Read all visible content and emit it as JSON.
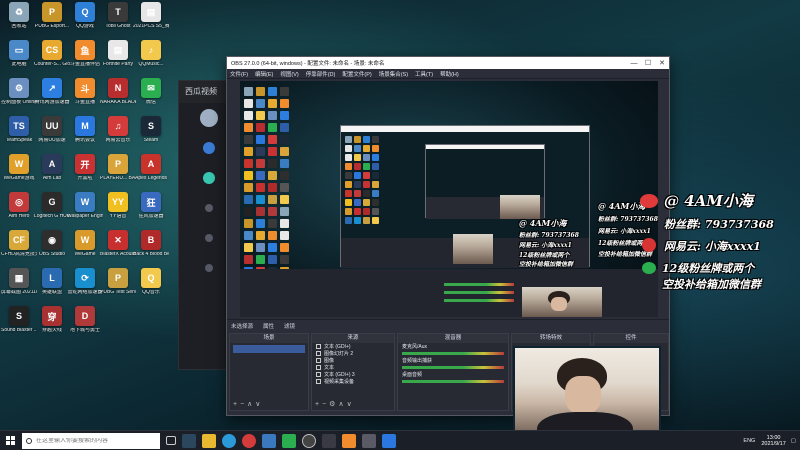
{
  "desktop_icons": [
    {
      "label": "回收站",
      "color": "#8aa4b8",
      "glyph": "♻",
      "icon": "recycle-bin-icon"
    },
    {
      "label": "PUBG Esport...",
      "color": "#c8952a",
      "glyph": "P",
      "icon": "pubg-icon"
    },
    {
      "label": "QQ游戏",
      "color": "#2e7fd6",
      "glyph": "Q",
      "icon": "qq-game-icon"
    },
    {
      "label": "Tobii Ghost",
      "color": "#3a3a3a",
      "glyph": "T",
      "icon": "tobii-icon"
    },
    {
      "label": "2021PCS S5_赛格准...",
      "color": "#e6e6e6",
      "glyph": "▤",
      "icon": "document-icon"
    },
    {
      "label": "此电脑",
      "color": "#4a88c8",
      "glyph": "▭",
      "icon": "computer-icon"
    },
    {
      "label": "Counter-S... Global Off...",
      "color": "#e7a92f",
      "glyph": "CS",
      "icon": "csgo-icon"
    },
    {
      "label": "斗鱼直播伴侣",
      "color": "#f08c2e",
      "glyph": "鱼",
      "icon": "douyu-icon"
    },
    {
      "label": "Fortnite Party",
      "color": "#e8e8e8",
      "glyph": "▤",
      "icon": "document-icon"
    },
    {
      "label": "QQMusic...",
      "color": "#f2c94c",
      "glyph": "♪",
      "icon": "qqmusic-icon"
    },
    {
      "label": "控制面板 Online",
      "color": "#6a8fc0",
      "glyph": "⚙",
      "icon": "control-panel-icon"
    },
    {
      "label": "腾讯网游加速器",
      "color": "#2c7ee0",
      "glyph": "↗",
      "icon": "accelerator-icon"
    },
    {
      "label": "斗鱼直播",
      "color": "#f08c2e",
      "glyph": "斗",
      "icon": "douyu-live-icon"
    },
    {
      "label": "NARAKA BLADEPOI...",
      "color": "#b82d2d",
      "glyph": "N",
      "icon": "naraka-icon"
    },
    {
      "label": "微信",
      "color": "#2aae4f",
      "glyph": "✉",
      "icon": "wechat-icon"
    },
    {
      "label": "TeamSpeak",
      "color": "#2f5ea8",
      "glyph": "TS",
      "icon": "teamspeak-icon"
    },
    {
      "label": "网易UU加速",
      "color": "#3a3a3a",
      "glyph": "UU",
      "icon": "uu-icon"
    },
    {
      "label": "腾讯会议",
      "color": "#2a77e0",
      "glyph": "M",
      "icon": "meeting-icon"
    },
    {
      "label": "网易云音乐",
      "color": "#d43c3c",
      "glyph": "♫",
      "icon": "netease-music-icon"
    },
    {
      "label": "Steam",
      "color": "#1b2838",
      "glyph": "S",
      "icon": "steam-icon"
    },
    {
      "label": "WeGame游戏",
      "color": "#e0a02a",
      "glyph": "W",
      "icon": "wegame-icon"
    },
    {
      "label": "Aim Lab",
      "color": "#2a3a5a",
      "glyph": "A",
      "icon": "aimlab-icon"
    },
    {
      "label": "开黑啦",
      "color": "#c83232",
      "glyph": "开",
      "icon": "kaiheila-icon"
    },
    {
      "label": "PLAYERU... BATTLEGR...",
      "color": "#d9a53a",
      "glyph": "P",
      "icon": "pubg-battlegrounds-icon"
    },
    {
      "label": "Apex Legends",
      "color": "#c8332c",
      "glyph": "A",
      "icon": "apex-icon"
    },
    {
      "label": "Aim Hero",
      "color": "#c23a3a",
      "glyph": "◎",
      "icon": "aimhero-icon"
    },
    {
      "label": "Logitech G HUB",
      "color": "#2b2b2b",
      "glyph": "G",
      "icon": "ghub-icon"
    },
    {
      "label": "Wallpaper Engine",
      "color": "#3a7cc2",
      "glyph": "W",
      "icon": "wallpaper-icon"
    },
    {
      "label": "YY语音",
      "color": "#f0c020",
      "glyph": "YY",
      "icon": "yy-icon"
    },
    {
      "label": "狂风加速器",
      "color": "#3a6ac0",
      "glyph": "狂",
      "icon": "accel-icon"
    },
    {
      "label": "CFHD高清竞技大区",
      "color": "#d8a838",
      "glyph": "CF",
      "icon": "cfhd-icon"
    },
    {
      "label": "OBS Studio",
      "color": "#2e2e2e",
      "glyph": "◉",
      "icon": "obs-icon"
    },
    {
      "label": "WeGame",
      "color": "#d89a2a",
      "glyph": "W",
      "icon": "wegame2-icon"
    },
    {
      "label": "BlasterX Acoustic...",
      "color": "#c83030",
      "glyph": "✕",
      "icon": "blasterx-icon"
    },
    {
      "label": "Back 4 Blood Beta",
      "color": "#b02a2a",
      "glyph": "B",
      "icon": "back4blood-icon"
    },
    {
      "label": "屏幕截图 2021101...",
      "color": "#555",
      "glyph": "▦",
      "icon": "screenshot-icon"
    },
    {
      "label": "英雄联盟",
      "color": "#2a6ab0",
      "glyph": "L",
      "icon": "lol-icon"
    },
    {
      "label": "雷蛇网络加速器",
      "color": "#1a8fd0",
      "glyph": "⟳",
      "icon": "razer-icon"
    },
    {
      "label": "PUBG Test Server",
      "color": "#c8a040",
      "glyph": "P",
      "icon": "pubg-test-icon"
    },
    {
      "label": "QQ音乐",
      "color": "#f2c94c",
      "glyph": "Q",
      "icon": "qq-icon"
    },
    {
      "label": "Sound Blaster ...",
      "color": "#222",
      "glyph": "S",
      "icon": "soundblaster-icon"
    },
    {
      "label": "穿越火线",
      "color": "#a83232",
      "glyph": "穿",
      "icon": "crossfire-icon"
    },
    {
      "label": "地下城与勇士",
      "color": "#b03a3a",
      "glyph": "D",
      "icon": "dnf-icon"
    }
  ],
  "bg_window": {
    "title": "西瓜视频"
  },
  "obs": {
    "title": "OBS 27.0.0 (64-bit, windows) - 配置文件: 未命名 - 场景: 未命名",
    "menu": [
      "文件(F)",
      "编辑(E)",
      "视图(V)",
      "停靠部件(D)",
      "配置文件(P)",
      "场景集合(S)",
      "工具(T)",
      "帮助(H)"
    ],
    "window_buttons": {
      "minimize": "—",
      "maximize": "☐",
      "close": "✕"
    },
    "source_bar": [
      "未选择源",
      "属性",
      "滤镜"
    ],
    "panels": {
      "scenes": "场景",
      "sources": "来源",
      "mixer": "混音器",
      "transitions": "转场特效",
      "controls": "控件"
    },
    "sources": [
      "文本 (GDI+)",
      "图像幻灯片 2",
      "图像",
      "文本",
      "文本 (GDI+) 3",
      "视频采集设备"
    ],
    "mixer_tracks": [
      "麦克风/Aux",
      "音频输出捕获",
      "桌面音频"
    ],
    "status": "CPU: 1.2%"
  },
  "overlay": {
    "handle": "@ 4AM小海",
    "fans": "粉丝群: 793737368",
    "netease": "网易云: 小海xxxx1",
    "note_line1": "12级粉丝牌或两个",
    "note_line2": "空投补给箱加微信群"
  },
  "taskbar": {
    "search_placeholder": "在这里输入你要搜索的内容",
    "tray_lang": "ENG",
    "time": "13:00",
    "date": "2021/9/17"
  },
  "colors": {
    "desktop_bg": "#123a44",
    "obs_bg": "#2b2e38",
    "meter_green": "#38a84a",
    "selected": "#3a5c9c"
  }
}
